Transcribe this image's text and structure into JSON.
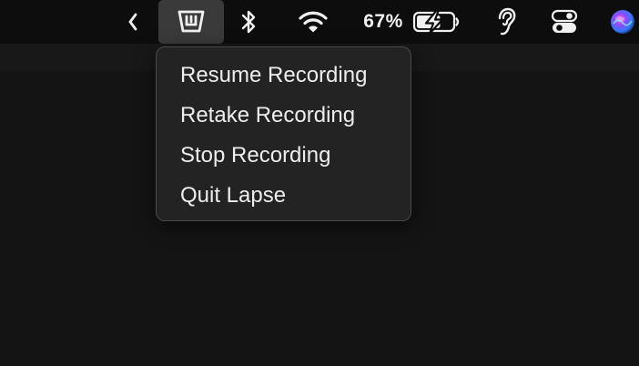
{
  "menubar": {
    "battery_percent": "67%",
    "battery_level": 0.67,
    "icons": {
      "collapse": "chevron-left-icon",
      "lapse": "lapse-app-icon",
      "bluetooth": "bluetooth-icon",
      "wifi": "wifi-icon",
      "battery": "battery-charging-icon",
      "hearing": "ear-icon",
      "control_center": "control-center-icon",
      "siri": "siri-icon"
    }
  },
  "lapse_menu": {
    "items": [
      {
        "label": "Resume Recording"
      },
      {
        "label": "Retake Recording"
      },
      {
        "label": "Stop Recording"
      },
      {
        "label": "Quit Lapse"
      }
    ]
  },
  "colors": {
    "menubar_bg": "#0d0d0d",
    "desktop_bg": "#141414",
    "menu_bg": "#232323",
    "active_item_bg": "#3a3a3a",
    "text": "#ededed"
  }
}
